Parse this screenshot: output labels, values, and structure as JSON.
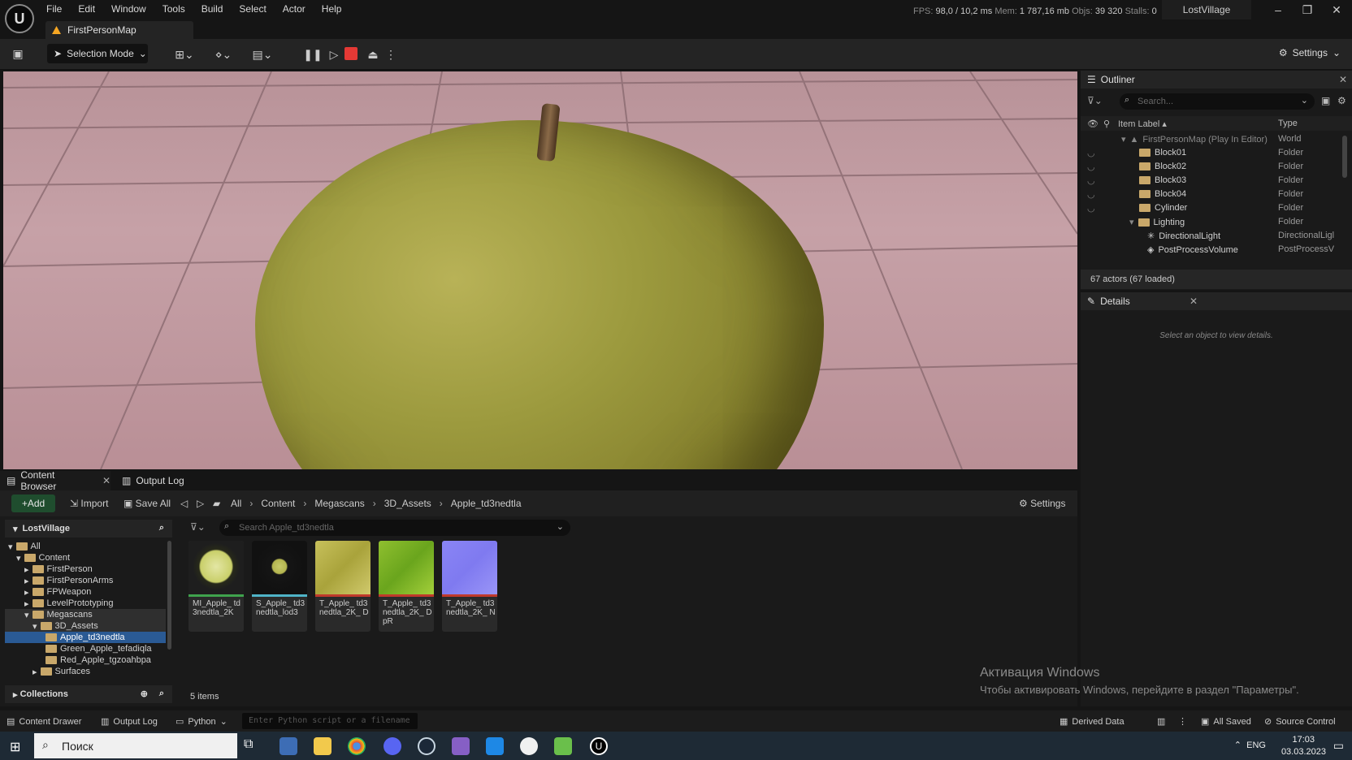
{
  "app": {
    "menus": [
      "File",
      "Edit",
      "Window",
      "Tools",
      "Build",
      "Select",
      "Actor",
      "Help"
    ],
    "map_tab": "FirstPersonMap",
    "project_name": "LostVillage",
    "stats": {
      "fps_label": "FPS:",
      "fps": "98,0",
      "ms": "/ 10,2 ms",
      "mem_label": "Mem:",
      "mem": "1 787,16 mb",
      "objs_label": "Objs:",
      "objs": "39 320",
      "stalls_label": "Stalls:",
      "stalls": "0"
    }
  },
  "toolbar": {
    "selection_mode": "Selection Mode",
    "settings": "Settings"
  },
  "outliner": {
    "title": "Outliner",
    "search_placeholder": "Search...",
    "col_label": "Item Label ▴",
    "col_type": "Type",
    "items": [
      {
        "label": "FirstPersonMap (Play In Editor)",
        "type": "World"
      },
      {
        "label": "Block01",
        "type": "Folder"
      },
      {
        "label": "Block02",
        "type": "Folder"
      },
      {
        "label": "Block03",
        "type": "Folder"
      },
      {
        "label": "Block04",
        "type": "Folder"
      },
      {
        "label": "Cylinder",
        "type": "Folder"
      },
      {
        "label": "Lighting",
        "type": "Folder"
      },
      {
        "label": "DirectionalLight",
        "type": "DirectionalLigl"
      },
      {
        "label": "PostProcessVolume",
        "type": "PostProcessV"
      }
    ],
    "actor_count": "67 actors (67 loaded)"
  },
  "details": {
    "title": "Details",
    "empty_message": "Select an object to view details."
  },
  "content_browser": {
    "tab": "Content Browser",
    "output_log_tab": "Output Log",
    "add": "Add",
    "import": "Import",
    "save_all": "Save All",
    "settings": "Settings",
    "breadcrumbs": [
      "All",
      "Content",
      "Megascans",
      "3D_Assets",
      "Apple_td3nedtla"
    ],
    "tree_root": "LostVillage",
    "tree": [
      {
        "label": "All",
        "depth": 0
      },
      {
        "label": "Content",
        "depth": 1
      },
      {
        "label": "FirstPerson",
        "depth": 2
      },
      {
        "label": "FirstPersonArms",
        "depth": 2
      },
      {
        "label": "FPWeapon",
        "depth": 2
      },
      {
        "label": "LevelPrototyping",
        "depth": 2
      },
      {
        "label": "Megascans",
        "depth": 2
      },
      {
        "label": "3D_Assets",
        "depth": 3
      },
      {
        "label": "Apple_td3nedtla",
        "depth": 4
      },
      {
        "label": "Green_Apple_tefadiqla",
        "depth": 4
      },
      {
        "label": "Red_Apple_tgzoahbpa",
        "depth": 4
      },
      {
        "label": "Surfaces",
        "depth": 3
      }
    ],
    "collections": "Collections",
    "search_placeholder": "Search Apple_td3nedtla",
    "assets": [
      {
        "name": "MI_Apple_ td3nedtla_2K",
        "bar": "#3fa34d"
      },
      {
        "name": "S_Apple_ td3nedtla_lod3",
        "bar": "#4fb4c8"
      },
      {
        "name": "T_Apple_ td3nedtla_2K_ D",
        "bar": "#c0392b"
      },
      {
        "name": "T_Apple_ td3nedtla_2K_ DpR",
        "bar": "#c0392b"
      },
      {
        "name": "T_Apple_ td3nedtla_2K_ N",
        "bar": "#c0392b"
      }
    ],
    "item_count": "5 items"
  },
  "watermark": {
    "line1": "Активация Windows",
    "line2": "Чтобы активировать Windows, перейдите в раздел \"Параметры\"."
  },
  "statusbar": {
    "content_drawer": "Content Drawer",
    "output_log": "Output Log",
    "python": "Python",
    "python_placeholder": "Enter Python script or a filename",
    "derived_data": "Derived Data",
    "all_saved": "All Saved",
    "source_control": "Source Control"
  },
  "taskbar": {
    "search": "Поиск",
    "lang": "ENG",
    "time": "17:03",
    "date": "03.03.2023"
  }
}
